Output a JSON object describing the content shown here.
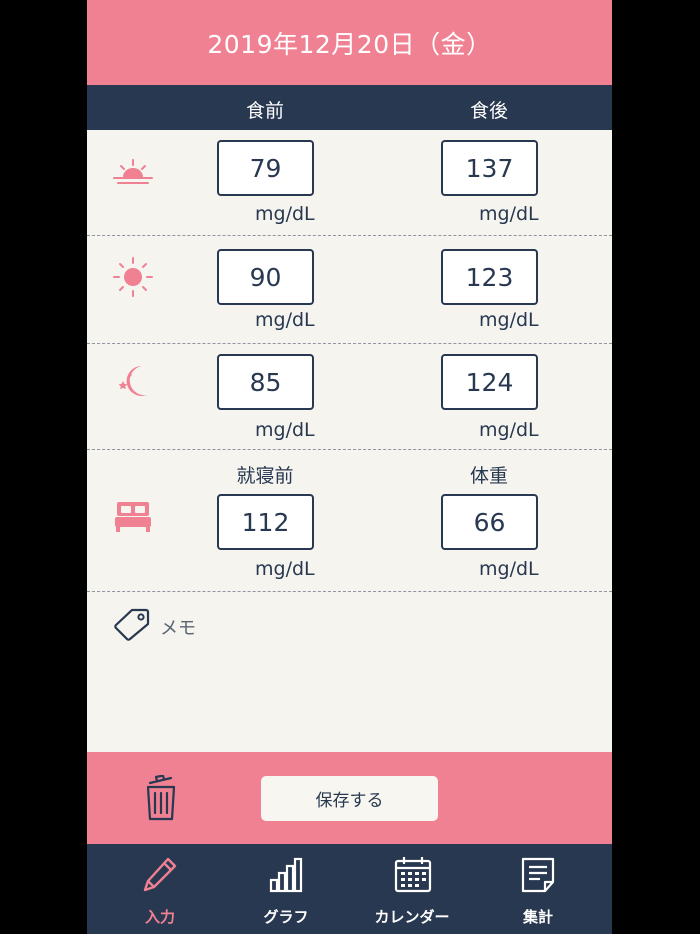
{
  "header": {
    "date": "2019年12月20日（金）"
  },
  "columns": {
    "before": "食前",
    "after": "食後"
  },
  "rows": [
    {
      "name": "morning",
      "icon": "sunrise-icon",
      "before": "79",
      "after": "137",
      "unit": "mg/dL"
    },
    {
      "name": "noon",
      "icon": "sun-icon",
      "before": "90",
      "after": "123",
      "unit": "mg/dL"
    },
    {
      "name": "evening",
      "icon": "moon-icon",
      "before": "85",
      "after": "124",
      "unit": "mg/dL"
    }
  ],
  "bedtime": {
    "icon": "bed-icon",
    "bedtime_label": "就寝前",
    "bedtime_value": "112",
    "weight_label": "体重",
    "weight_value": "66",
    "unit": "mg/dL"
  },
  "memo": {
    "label": "メモ",
    "icon": "tag-icon"
  },
  "actions": {
    "save_label": "保存する",
    "delete_icon": "trash-icon"
  },
  "tabs": [
    {
      "label": "入力",
      "icon": "pencil-icon",
      "active": true
    },
    {
      "label": "グラフ",
      "icon": "bar-chart-icon",
      "active": false
    },
    {
      "label": "カレンダー",
      "icon": "calendar-icon",
      "active": false
    },
    {
      "label": "集計",
      "icon": "document-icon",
      "active": false
    }
  ],
  "colors": {
    "accent": "#f08193",
    "navy": "#283850",
    "background": "#f5f4ef"
  }
}
